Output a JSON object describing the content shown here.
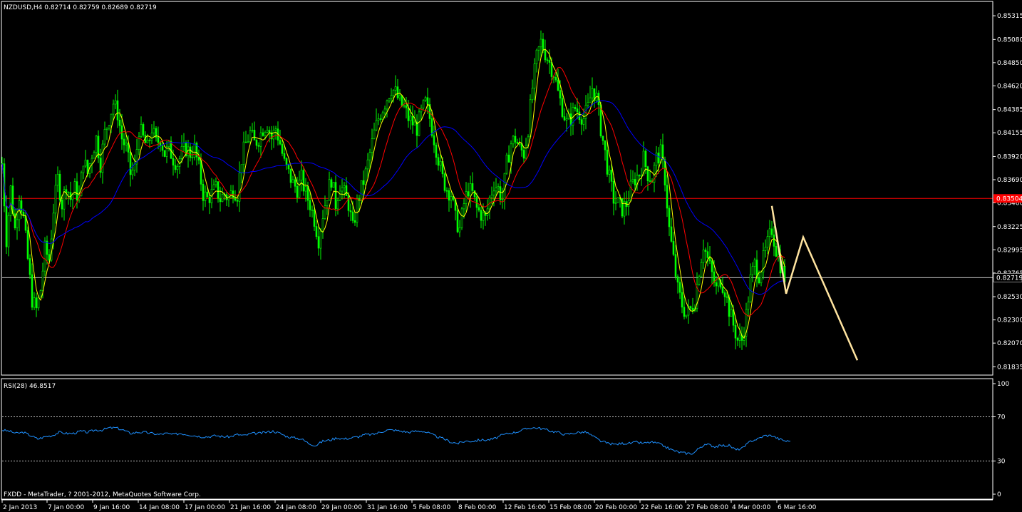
{
  "chart_data": [
    {
      "type": "candlestick",
      "symbol_header": "NZDUSD,H4  0.82714 0.82759 0.82689 0.82719",
      "ohlc_current": {
        "open": 0.82714,
        "high": 0.82759,
        "low": 0.82689,
        "close": 0.82719
      },
      "y_ticks": [
        "0.85315",
        "0.85080",
        "0.84850",
        "0.84620",
        "0.84385",
        "0.84155",
        "0.83920",
        "0.83690",
        "0.83460",
        "0.83225",
        "0.82995",
        "0.82765",
        "0.82530",
        "0.82300",
        "0.82070",
        "0.81835"
      ],
      "ylim": [
        0.8176,
        0.8545
      ],
      "x_ticks": [
        "2 Jan 2013",
        "7 Jan 00:00",
        "9 Jan 16:00",
        "14 Jan 08:00",
        "17 Jan 00:00",
        "21 Jan 16:00",
        "24 Jan 08:00",
        "29 Jan 00:00",
        "31 Jan 16:00",
        "5 Feb 08:00",
        "8 Feb 00:00",
        "12 Feb 16:00",
        "15 Feb 08:00",
        "20 Feb 00:00",
        "22 Feb 16:00",
        "27 Feb 08:00",
        "4 Mar 00:00",
        "6 Mar 16:00"
      ],
      "horizontal_levels": [
        {
          "value": 0.83504,
          "label": "0.83504",
          "color": "#ff0000"
        },
        {
          "value": 0.82719,
          "label": "0.82719",
          "color": "#c0c0c0"
        }
      ],
      "close_path": [
        [
          0,
          0.8385
        ],
        [
          6,
          0.831
        ],
        [
          12,
          0.836
        ],
        [
          18,
          0.832
        ],
        [
          24,
          0.8355
        ],
        [
          30,
          0.833
        ],
        [
          36,
          0.829
        ],
        [
          42,
          0.825
        ],
        [
          48,
          0.824
        ],
        [
          54,
          0.826
        ],
        [
          60,
          0.83
        ],
        [
          66,
          0.829
        ],
        [
          72,
          0.834
        ],
        [
          78,
          0.837
        ],
        [
          84,
          0.8345
        ],
        [
          90,
          0.8365
        ],
        [
          96,
          0.835
        ],
        [
          102,
          0.836
        ],
        [
          108,
          0.835
        ],
        [
          114,
          0.839
        ],
        [
          120,
          0.8375
        ],
        [
          126,
          0.8395
        ],
        [
          132,
          0.841
        ],
        [
          138,
          0.8385
        ],
        [
          144,
          0.8415
        ],
        [
          150,
          0.843
        ],
        [
          156,
          0.8445
        ],
        [
          162,
          0.8435
        ],
        [
          168,
          0.841
        ],
        [
          174,
          0.84
        ],
        [
          180,
          0.8375
        ],
        [
          186,
          0.838
        ],
        [
          192,
          0.842
        ],
        [
          198,
          0.841
        ],
        [
          204,
          0.84
        ],
        [
          210,
          0.842
        ],
        [
          216,
          0.8405
        ],
        [
          222,
          0.841
        ],
        [
          228,
          0.8395
        ],
        [
          234,
          0.84
        ],
        [
          240,
          0.839
        ],
        [
          246,
          0.8385
        ],
        [
          252,
          0.8395
        ],
        [
          258,
          0.84
        ],
        [
          264,
          0.8395
        ],
        [
          270,
          0.84
        ],
        [
          276,
          0.838
        ],
        [
          282,
          0.8355
        ],
        [
          288,
          0.835
        ],
        [
          294,
          0.8355
        ],
        [
          300,
          0.836
        ],
        [
          306,
          0.835
        ],
        [
          312,
          0.8355
        ],
        [
          318,
          0.835
        ],
        [
          324,
          0.836
        ],
        [
          330,
          0.8355
        ],
        [
          336,
          0.839
        ],
        [
          342,
          0.8405
        ],
        [
          348,
          0.8415
        ],
        [
          354,
          0.8405
        ],
        [
          360,
          0.841
        ],
        [
          366,
          0.842
        ],
        [
          372,
          0.8425
        ],
        [
          378,
          0.841
        ],
        [
          384,
          0.842
        ],
        [
          390,
          0.8405
        ],
        [
          396,
          0.8385
        ],
        [
          402,
          0.8375
        ],
        [
          408,
          0.8365
        ],
        [
          414,
          0.836
        ],
        [
          420,
          0.837
        ],
        [
          426,
          0.8355
        ],
        [
          432,
          0.8345
        ],
        [
          438,
          0.833
        ],
        [
          444,
          0.831
        ],
        [
          450,
          0.8335
        ],
        [
          456,
          0.8355
        ],
        [
          462,
          0.837
        ],
        [
          468,
          0.8345
        ],
        [
          474,
          0.8365
        ],
        [
          480,
          0.8355
        ],
        [
          486,
          0.8345
        ],
        [
          492,
          0.832
        ],
        [
          498,
          0.8345
        ],
        [
          504,
          0.836
        ],
        [
          510,
          0.8375
        ],
        [
          516,
          0.8395
        ],
        [
          522,
          0.8415
        ],
        [
          528,
          0.843
        ],
        [
          534,
          0.844
        ],
        [
          540,
          0.845
        ],
        [
          546,
          0.846
        ],
        [
          552,
          0.8455
        ],
        [
          558,
          0.8445
        ],
        [
          564,
          0.844
        ],
        [
          570,
          0.843
        ],
        [
          576,
          0.8425
        ],
        [
          582,
          0.842
        ],
        [
          588,
          0.8435
        ],
        [
          594,
          0.8445
        ],
        [
          600,
          0.843
        ],
        [
          606,
          0.841
        ],
        [
          612,
          0.839
        ],
        [
          618,
          0.837
        ],
        [
          624,
          0.836
        ],
        [
          630,
          0.8355
        ],
        [
          636,
          0.833
        ],
        [
          642,
          0.832
        ],
        [
          648,
          0.8345
        ],
        [
          654,
          0.836
        ],
        [
          660,
          0.8355
        ],
        [
          666,
          0.834
        ],
        [
          672,
          0.8335
        ],
        [
          678,
          0.833
        ],
        [
          684,
          0.835
        ],
        [
          690,
          0.8365
        ],
        [
          696,
          0.836
        ],
        [
          702,
          0.835
        ],
        [
          708,
          0.8385
        ],
        [
          714,
          0.8405
        ],
        [
          720,
          0.841
        ],
        [
          726,
          0.84
        ],
        [
          732,
          0.8395
        ],
        [
          738,
          0.842
        ],
        [
          744,
          0.846
        ],
        [
          750,
          0.849
        ],
        [
          756,
          0.8505
        ],
        [
          762,
          0.8495
        ],
        [
          768,
          0.8485
        ],
        [
          774,
          0.8475
        ],
        [
          780,
          0.8455
        ],
        [
          786,
          0.844
        ],
        [
          792,
          0.8425
        ],
        [
          798,
          0.843
        ],
        [
          804,
          0.844
        ],
        [
          810,
          0.8435
        ],
        [
          816,
          0.843
        ],
        [
          822,
          0.844
        ],
        [
          828,
          0.846
        ],
        [
          834,
          0.845
        ],
        [
          840,
          0.842
        ],
        [
          846,
          0.8395
        ],
        [
          852,
          0.837
        ],
        [
          858,
          0.835
        ],
        [
          864,
          0.8345
        ],
        [
          870,
          0.834
        ],
        [
          876,
          0.8345
        ],
        [
          882,
          0.836
        ],
        [
          888,
          0.837
        ],
        [
          894,
          0.8375
        ],
        [
          900,
          0.839
        ],
        [
          906,
          0.8375
        ],
        [
          912,
          0.837
        ],
        [
          918,
          0.839
        ],
        [
          924,
          0.8395
        ],
        [
          930,
          0.837
        ],
        [
          936,
          0.832
        ],
        [
          942,
          0.829
        ],
        [
          948,
          0.826
        ],
        [
          954,
          0.8245
        ],
        [
          960,
          0.8235
        ],
        [
          966,
          0.824
        ],
        [
          972,
          0.825
        ],
        [
          978,
          0.828
        ],
        [
          984,
          0.8305
        ],
        [
          990,
          0.829
        ],
        [
          996,
          0.8275
        ],
        [
          1002,
          0.826
        ],
        [
          1008,
          0.827
        ],
        [
          1014,
          0.826
        ],
        [
          1020,
          0.824
        ],
        [
          1026,
          0.8225
        ],
        [
          1032,
          0.821
        ],
        [
          1038,
          0.821
        ],
        [
          1044,
          0.8235
        ],
        [
          1050,
          0.827
        ],
        [
          1056,
          0.8285
        ],
        [
          1062,
          0.8275
        ],
        [
          1068,
          0.829
        ],
        [
          1074,
          0.8305
        ],
        [
          1080,
          0.832
        ],
        [
          1086,
          0.83
        ],
        [
          1092,
          0.8285
        ],
        [
          1098,
          0.8272
        ],
        [
          1102,
          0.8272
        ]
      ],
      "zigzag_projection": [
        [
          1080,
          0.8343
        ],
        [
          1100,
          0.8256
        ],
        [
          1124,
          0.8312
        ],
        [
          1200,
          0.819
        ]
      ],
      "rsi": {
        "label": "RSI(28) 46.8517",
        "period": 28,
        "value": 46.8517,
        "y_ticks": [
          "100",
          "70",
          "30",
          "0"
        ],
        "levels": [
          70,
          30
        ],
        "values": [
          [
            0,
            58
          ],
          [
            10,
            57
          ],
          [
            20,
            55
          ],
          [
            30,
            56
          ],
          [
            40,
            53
          ],
          [
            50,
            50
          ],
          [
            60,
            52
          ],
          [
            70,
            53
          ],
          [
            80,
            56
          ],
          [
            90,
            55
          ],
          [
            100,
            55
          ],
          [
            110,
            57
          ],
          [
            120,
            56
          ],
          [
            130,
            58
          ],
          [
            140,
            58
          ],
          [
            150,
            60
          ],
          [
            160,
            60
          ],
          [
            170,
            58
          ],
          [
            180,
            55
          ],
          [
            190,
            56
          ],
          [
            200,
            56
          ],
          [
            210,
            55
          ],
          [
            220,
            54
          ],
          [
            230,
            55
          ],
          [
            240,
            54
          ],
          [
            250,
            55
          ],
          [
            260,
            54
          ],
          [
            270,
            53
          ],
          [
            280,
            52
          ],
          [
            290,
            52
          ],
          [
            300,
            53
          ],
          [
            310,
            52
          ],
          [
            320,
            52
          ],
          [
            330,
            54
          ],
          [
            340,
            53
          ],
          [
            350,
            55
          ],
          [
            360,
            55
          ],
          [
            370,
            56
          ],
          [
            380,
            57
          ],
          [
            390,
            55
          ],
          [
            400,
            52
          ],
          [
            410,
            51
          ],
          [
            420,
            50
          ],
          [
            430,
            46
          ],
          [
            440,
            44
          ],
          [
            450,
            48
          ],
          [
            460,
            49
          ],
          [
            470,
            51
          ],
          [
            480,
            50
          ],
          [
            490,
            51
          ],
          [
            500,
            52
          ],
          [
            510,
            54
          ],
          [
            520,
            54
          ],
          [
            530,
            56
          ],
          [
            540,
            58
          ],
          [
            550,
            58
          ],
          [
            560,
            57
          ],
          [
            570,
            56
          ],
          [
            580,
            57
          ],
          [
            590,
            57
          ],
          [
            600,
            55
          ],
          [
            610,
            52
          ],
          [
            620,
            50
          ],
          [
            630,
            47
          ],
          [
            640,
            46
          ],
          [
            650,
            48
          ],
          [
            660,
            48
          ],
          [
            670,
            49
          ],
          [
            680,
            49
          ],
          [
            690,
            50
          ],
          [
            700,
            53
          ],
          [
            710,
            55
          ],
          [
            720,
            56
          ],
          [
            730,
            58
          ],
          [
            740,
            60
          ],
          [
            750,
            60
          ],
          [
            760,
            59
          ],
          [
            770,
            57
          ],
          [
            780,
            56
          ],
          [
            790,
            54
          ],
          [
            800,
            55
          ],
          [
            810,
            56
          ],
          [
            820,
            56
          ],
          [
            830,
            52
          ],
          [
            840,
            48
          ],
          [
            850,
            46
          ],
          [
            860,
            45
          ],
          [
            870,
            46
          ],
          [
            880,
            46
          ],
          [
            890,
            47
          ],
          [
            900,
            46
          ],
          [
            910,
            47
          ],
          [
            920,
            46
          ],
          [
            930,
            43
          ],
          [
            940,
            40
          ],
          [
            950,
            38
          ],
          [
            960,
            37
          ],
          [
            970,
            37
          ],
          [
            980,
            43
          ],
          [
            990,
            45
          ],
          [
            1000,
            43
          ],
          [
            1010,
            44
          ],
          [
            1020,
            44
          ],
          [
            1030,
            40
          ],
          [
            1040,
            42
          ],
          [
            1050,
            48
          ],
          [
            1060,
            50
          ],
          [
            1070,
            53
          ],
          [
            1080,
            53
          ],
          [
            1090,
            50
          ],
          [
            1100,
            48
          ],
          [
            1106,
            48
          ]
        ]
      }
    }
  ],
  "footer": {
    "text": "FXDD - MetaTrader, ? 2001-2012, MetaQuotes Software Corp."
  },
  "colors": {
    "background": "#000000",
    "frame": "#ffffff",
    "candle_bull": "#00ff00",
    "candle_bear": "#00ff00",
    "ma_fast": "#ffff00",
    "ma_medium": "#ff0000",
    "ma_slow": "#0000ff",
    "rsi_line": "#1e90ff",
    "zigzag": "#ffe4a0",
    "text": "#ffffff"
  }
}
